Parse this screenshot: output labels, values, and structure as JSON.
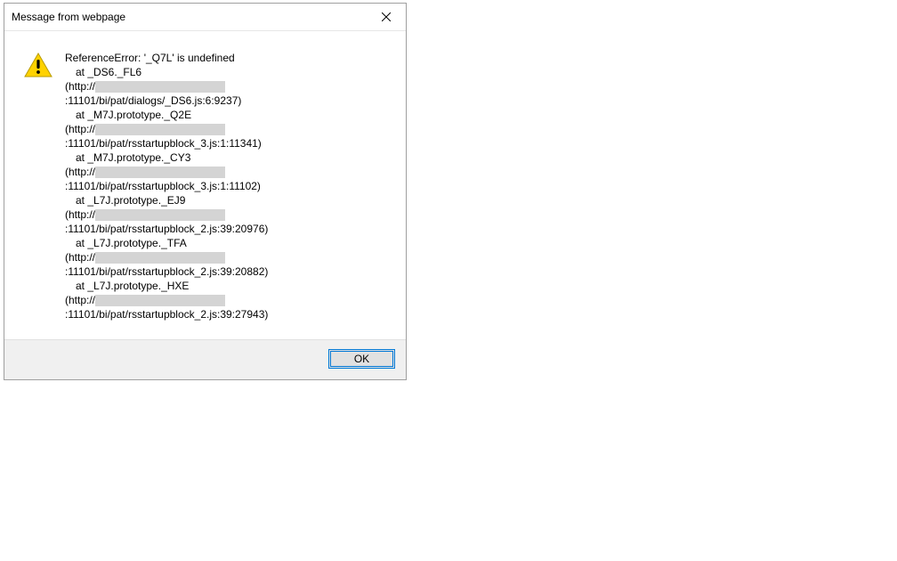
{
  "dialog": {
    "title": "Message from webpage",
    "ok_label": "OK",
    "close_tooltip": "Close"
  },
  "error": {
    "header": "ReferenceError: '_Q7L' is undefined",
    "frames": [
      {
        "at": "at _DS6._FL6",
        "prefix": "(http://",
        "redact_width": 146,
        "suffix": ":11101/bi/pat/dialogs/_DS6.js:6:9237)"
      },
      {
        "at": "at _M7J.prototype._Q2E",
        "prefix": "(http://",
        "redact_width": 146,
        "suffix": ":11101/bi/pat/rsstartupblock_3.js:1:11341)"
      },
      {
        "at": "at _M7J.prototype._CY3",
        "prefix": "(http://",
        "redact_width": 146,
        "suffix": ":11101/bi/pat/rsstartupblock_3.js:1:11102)"
      },
      {
        "at": "at _L7J.prototype._EJ9",
        "prefix": "(http://",
        "redact_width": 146,
        "suffix": ":11101/bi/pat/rsstartupblock_2.js:39:20976)"
      },
      {
        "at": "at _L7J.prototype._TFA",
        "prefix": "(http://",
        "redact_width": 146,
        "suffix": ":11101/bi/pat/rsstartupblock_2.js:39:20882)"
      },
      {
        "at": "at _L7J.prototype._HXE",
        "prefix": "(http://",
        "redact_width": 146,
        "suffix": ":11101/bi/pat/rsstartupblock_2.js:39:27943)"
      }
    ]
  }
}
